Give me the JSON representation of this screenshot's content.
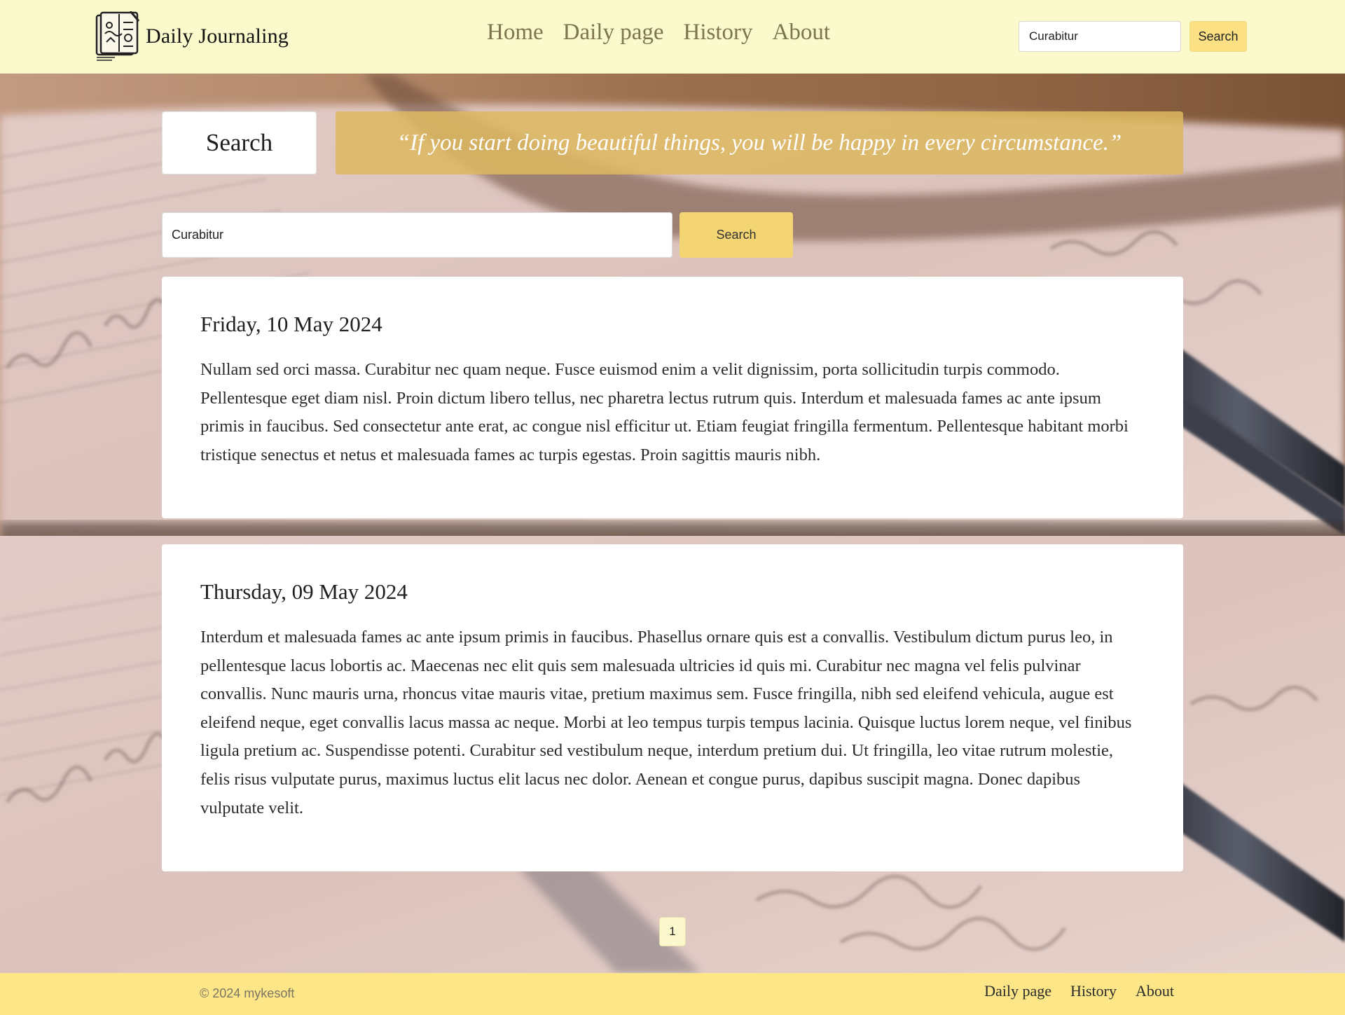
{
  "header": {
    "brand_name": "Daily Journaling",
    "nav": [
      {
        "label": "Home"
      },
      {
        "label": "Daily page"
      },
      {
        "label": "History"
      },
      {
        "label": "About"
      }
    ],
    "search_value": "Curabitur",
    "search_button": "Search"
  },
  "page": {
    "heading": "Search",
    "quote": "“If you start doing beautiful things, you will be happy in every circumstance.”",
    "search_value": "Curabitur",
    "search_button": "Search"
  },
  "entries": [
    {
      "date": "Friday, 10 May 2024",
      "body": "Nullam sed orci massa. Curabitur nec quam neque. Fusce euismod enim a velit dignissim, porta sollicitudin turpis commodo. Pellentesque eget diam nisl. Proin dictum libero tellus, nec pharetra lectus rutrum quis. Interdum et malesuada fames ac ante ipsum primis in faucibus. Sed consectetur ante erat, ac congue nisl efficitur ut. Etiam feugiat fringilla fermentum. Pellentesque habitant morbi tristique senectus et netus et malesuada fames ac turpis egestas. Proin sagittis mauris nibh."
    },
    {
      "date": "Thursday, 09 May 2024",
      "body": "Interdum et malesuada fames ac ante ipsum primis in faucibus. Phasellus ornare quis est a convallis. Vestibulum dictum purus leo, in pellentesque lacus lobortis ac. Maecenas nec elit quis sem malesuada ultricies id quis mi. Curabitur nec magna vel felis pulvinar convallis. Nunc mauris urna, rhoncus vitae mauris vitae, pretium maximus sem. Fusce fringilla, nibh sed eleifend vehicula, augue est eleifend neque, eget convallis lacus massa ac neque. Morbi at leo tempus turpis tempus lacinia. Quisque luctus lorem neque, vel finibus ligula pretium ac. Suspendisse potenti. Curabitur sed vestibulum neque, interdum pretium dui. Ut fringilla, leo vitae rutrum molestie, felis risus vulputate purus, maximus luctus elit lacus nec dolor. Aenean et congue purus, dapibus suscipit magna. Donec dapibus vulputate velit."
    }
  ],
  "pagination": {
    "current_page": "1"
  },
  "footer": {
    "copyright": "© 2024 mykesoft",
    "links": [
      {
        "label": "Daily page"
      },
      {
        "label": "History"
      },
      {
        "label": "About"
      }
    ]
  },
  "colors": {
    "header_bg": "#fafacd",
    "footer_bg": "#fde688",
    "accent_button": "#f3d574",
    "quote_bg": "#dcb860"
  },
  "icons": {
    "brand_logo": "journal-book-icon"
  }
}
